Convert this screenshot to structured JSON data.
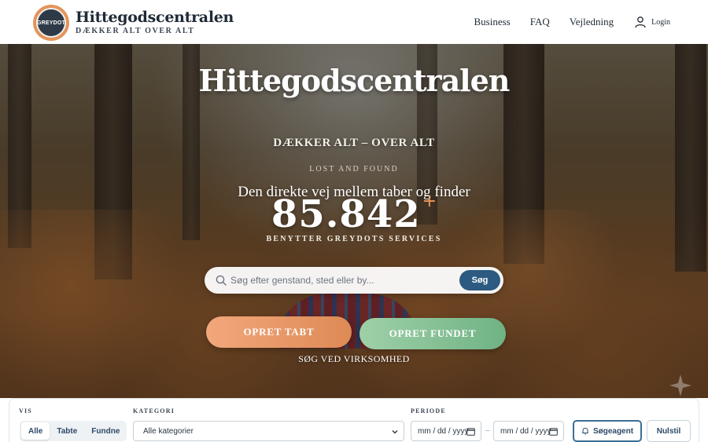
{
  "header": {
    "logo_text": "GREYDOT",
    "brand_title": "Hittegodscentralen",
    "brand_subtitle": "DÆKKER ALT OVER ALT",
    "nav": [
      "Business",
      "FAQ",
      "Vejledning"
    ],
    "login_label": "Login",
    "login_icon": "user-icon"
  },
  "hero": {
    "title": "Hittegodscentralen",
    "subtitle": "DÆKKER ALT – OVER ALT",
    "tagline": "LOST AND FOUND",
    "lead": "Den direkte vej mellem taber og finder",
    "counter_value": "85.842",
    "counter_suffix": "+",
    "counter_label": "BENYTTER GREYDOTS SERVICES",
    "search_placeholder": "Søg efter genstand, sted eller by...",
    "search_button": "Søg",
    "cta_lost": "OPRET TABT",
    "cta_found": "OPRET FUNDET",
    "company_link": "SØG VED VIRKSOMHED"
  },
  "filters": {
    "vis_label": "VIS",
    "vis_options": [
      "Alle",
      "Tabte",
      "Fundne"
    ],
    "vis_selected": "Alle",
    "kategori_label": "KATEGORI",
    "kategori_value": "Alle kategorier",
    "periode_label": "PERIODE",
    "date_from": "mm / dd / yyyy",
    "date_sep": "–",
    "date_to": "mm / dd / yyyy",
    "agent_button": "Søgeagent",
    "reset_button": "Nulstil"
  },
  "colors": {
    "accent_orange": "#e4945a",
    "accent_green": "#6fb383",
    "primary_blue": "#2c5a80",
    "dark_navy": "#1f2a36"
  }
}
